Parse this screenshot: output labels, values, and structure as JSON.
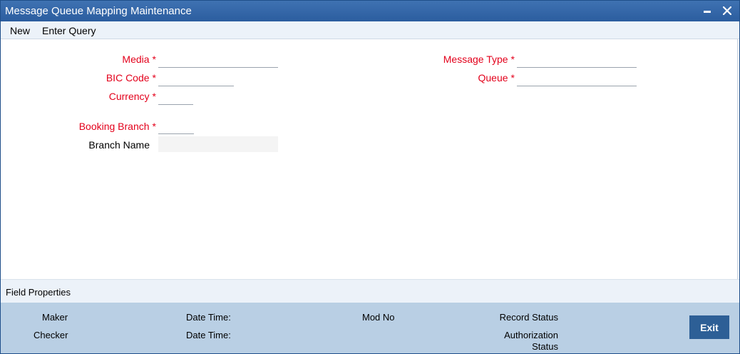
{
  "window": {
    "title": "Message Queue Mapping Maintenance"
  },
  "menu": {
    "new_label": "New",
    "enter_query_label": "Enter Query"
  },
  "form": {
    "media": {
      "label": "Media",
      "required": "*",
      "value": ""
    },
    "bic_code": {
      "label": "BIC Code",
      "required": "*",
      "value": ""
    },
    "currency": {
      "label": "Currency",
      "required": "*",
      "value": ""
    },
    "booking_branch": {
      "label": "Booking Branch",
      "required": "*",
      "value": ""
    },
    "branch_name": {
      "label": "Branch Name",
      "value": ""
    },
    "message_type": {
      "label": "Message Type",
      "required": "*",
      "value": ""
    },
    "queue": {
      "label": "Queue",
      "required": "*",
      "value": ""
    }
  },
  "field_properties": {
    "label": "Field Properties"
  },
  "audit": {
    "maker_label": "Maker",
    "checker_label": "Checker",
    "date_time_label": "Date Time:",
    "mod_no_label": "Mod No",
    "record_status_label": "Record Status",
    "authorization_label": "Authorization",
    "status_label": "Status",
    "exit_label": "Exit"
  },
  "colors": {
    "titlebar": "#2b5d9f",
    "required_label": "#e3001b",
    "audit_panel": "#b9cfe4",
    "exit_button": "#2d5f96"
  }
}
